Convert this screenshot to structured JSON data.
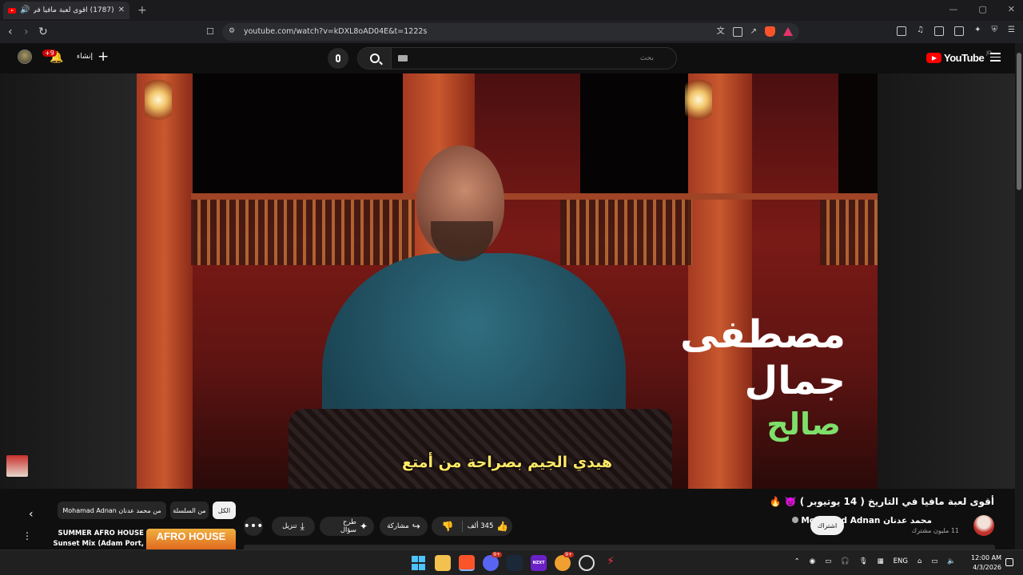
{
  "browser": {
    "tab_title": "(1787) أقوى لعبة مافيا في التا...",
    "new_tab_glyph": "+",
    "url": "youtube.com/watch?v=kDXL8oAD04E&t=1222s",
    "window_controls": [
      "—",
      "▢",
      "✕"
    ],
    "nav_icons": [
      "‹",
      "›",
      "↻"
    ]
  },
  "youtube": {
    "logo_text": "YouTube",
    "country_code": "JO",
    "search_placeholder": "بحث",
    "create_label": "إنشاء",
    "create_glyph": "+",
    "notification_badge": "+9",
    "bell_glyph": "🔔"
  },
  "video": {
    "name_first": "مصطفى",
    "name_middle": "جمال",
    "name_last": "صالح",
    "subtitle": "هيدي الجيم بصراحة من أمتع"
  },
  "details": {
    "title": "أقوى لعبة مافيا في التاريخ ( 14 يوتيوبر ) 👿 🔥",
    "channel_name": "محمد عدنان Mohamad Adnan",
    "subscribers": "11 مليون مشترك",
    "subscribe_label": "اشتراك",
    "like_count": "345 ألف",
    "share_label": "مشاركة",
    "ask_label": "طرح سؤال",
    "download_label": "تنزيل",
    "more_glyph": "•••"
  },
  "related": {
    "chips": [
      "الكل",
      "من السلسلة",
      "من محمد عدنان Mohamad Adnan"
    ],
    "prev_glyph": "‹",
    "item_title": "SUMMER AFRO HOUSE Sunset Mix (Adam Port, Avicii, The ...",
    "item_thumb_text": "AFRO HOUSE",
    "item_more_glyph": "⋮"
  },
  "taskbar": {
    "tray_lang": "ENG",
    "time": "12:00 AM",
    "date": "4/3/2026",
    "badges": {
      "brave": "9+",
      "steam": "9+"
    },
    "app_text": {
      "nzxt": "NZXT"
    }
  },
  "colors": {
    "yt_red": "#ff0000",
    "subtitle_yellow": "#ffe866",
    "name_green": "#7ee06b",
    "bg": "#0f0f0f"
  }
}
